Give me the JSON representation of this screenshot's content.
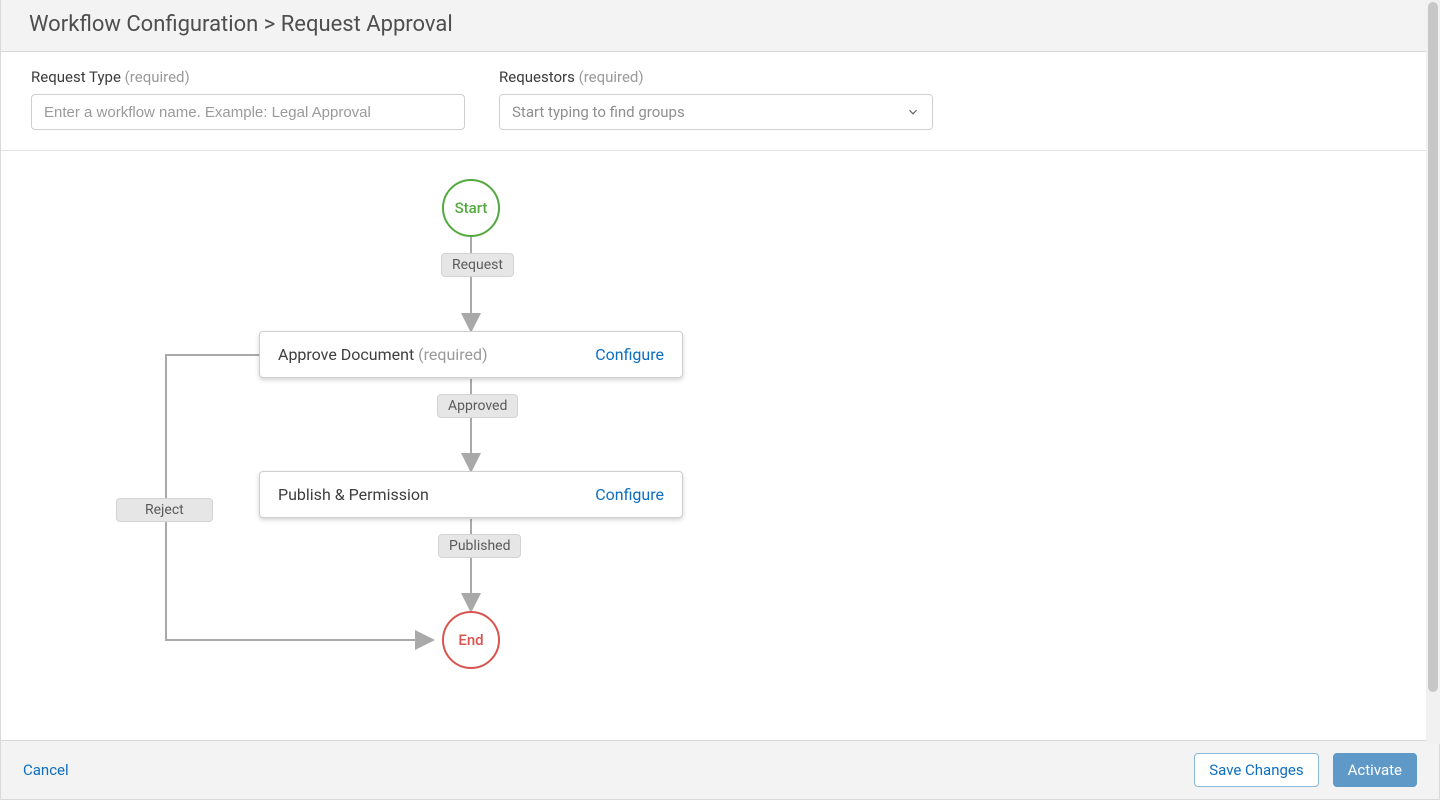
{
  "header": {
    "breadcrumb_parent": "Workflow Configuration",
    "breadcrumb_sep": " > ",
    "breadcrumb_current": "Request Approval"
  },
  "form": {
    "request_type": {
      "label": "Request Type",
      "required_text": "(required)",
      "placeholder": "Enter a workflow name. Example: Legal Approval",
      "value": ""
    },
    "requestors": {
      "label": "Requestors",
      "required_text": "(required)",
      "placeholder": "Start typing to find groups",
      "value": ""
    }
  },
  "workflow": {
    "start_label": "Start",
    "end_label": "End",
    "nodes": [
      {
        "id": "approve",
        "title": "Approve Document",
        "required_text": "(required)",
        "configure_label": "Configure"
      },
      {
        "id": "publish",
        "title": "Publish & Permission",
        "required_text": "",
        "configure_label": "Configure"
      }
    ],
    "edge_labels": {
      "request": "Request",
      "approved": "Approved",
      "published": "Published",
      "reject": "Reject"
    }
  },
  "footer": {
    "cancel": "Cancel",
    "save": "Save Changes",
    "activate": "Activate"
  },
  "colors": {
    "start": "#53a93f",
    "end": "#d9534f",
    "link": "#0d6ebf",
    "primary": "#5f99c7"
  }
}
